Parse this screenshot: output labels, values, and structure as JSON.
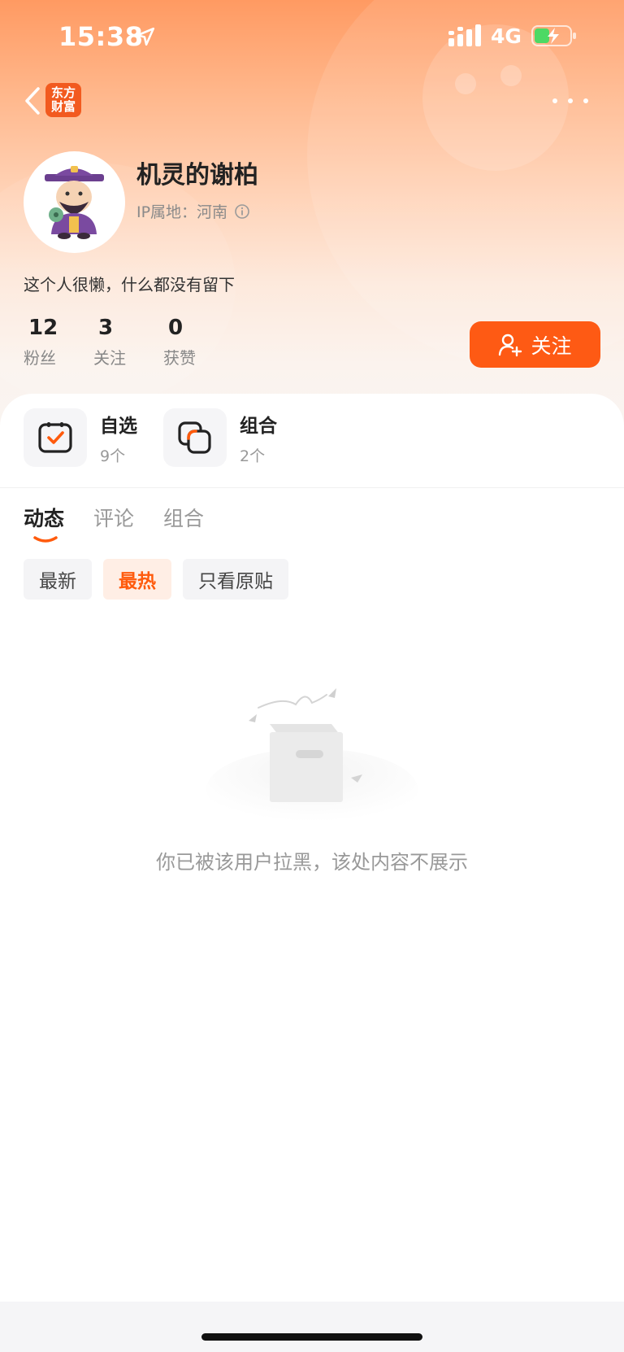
{
  "status_bar": {
    "time": "15:38",
    "network": "4G"
  },
  "nav": {
    "brand_logo_line1": "东方",
    "brand_logo_line2": "财富"
  },
  "profile": {
    "username": "机灵的谢柏",
    "ip_location": "IP属地：河南",
    "bio": "这个人很懒，什么都没有留下",
    "stats": [
      {
        "value": "12",
        "label": "粉丝"
      },
      {
        "value": "3",
        "label": "关注"
      },
      {
        "value": "0",
        "label": "获赞"
      }
    ],
    "follow_label": "关注"
  },
  "shortcuts": [
    {
      "title": "自选",
      "count": "9个",
      "icon": "checkbox-icon"
    },
    {
      "title": "组合",
      "count": "2个",
      "icon": "stack-icon"
    }
  ],
  "tabs": [
    {
      "label": "动态",
      "active": true
    },
    {
      "label": "评论",
      "active": false
    },
    {
      "label": "组合",
      "active": false
    }
  ],
  "filters": [
    {
      "label": "最新",
      "active": false
    },
    {
      "label": "最热",
      "active": true
    },
    {
      "label": "只看原贴",
      "active": false
    }
  ],
  "empty_state": {
    "message": "你已被该用户拉黑，该处内容不展示"
  },
  "colors": {
    "accent": "#fe5a14",
    "header_gradient_top": "#ff9a62",
    "header_gradient_bottom": "#f8f4f2"
  }
}
